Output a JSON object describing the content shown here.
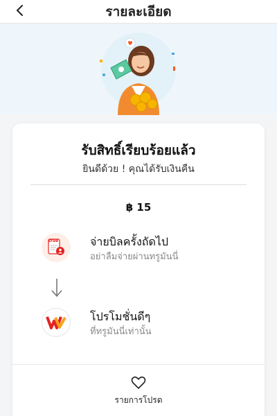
{
  "header": {
    "title": "รายละเอียด"
  },
  "card": {
    "title": "รับสิทธิ์เรียบร้อยแล้ว",
    "subtitle": "ยินดีด้วย ! คุณได้รับเงินคืน",
    "amount": "฿ 15"
  },
  "steps": [
    {
      "title": "จ่ายบิลครั้งถัดไป",
      "desc": "อย่าลืมจ่ายผ่านทรูมันนี่",
      "icon_text": "true"
    },
    {
      "title": "โปรโมชั่นดีๆ",
      "desc": "ที่ทรูมันนี่เท่านั้น"
    }
  ],
  "footer": {
    "favorite_label": "รายการโปรด"
  },
  "colors": {
    "accent": "#f15a24",
    "brand_red": "#e52320",
    "hero_bg": "#eef6fb"
  }
}
